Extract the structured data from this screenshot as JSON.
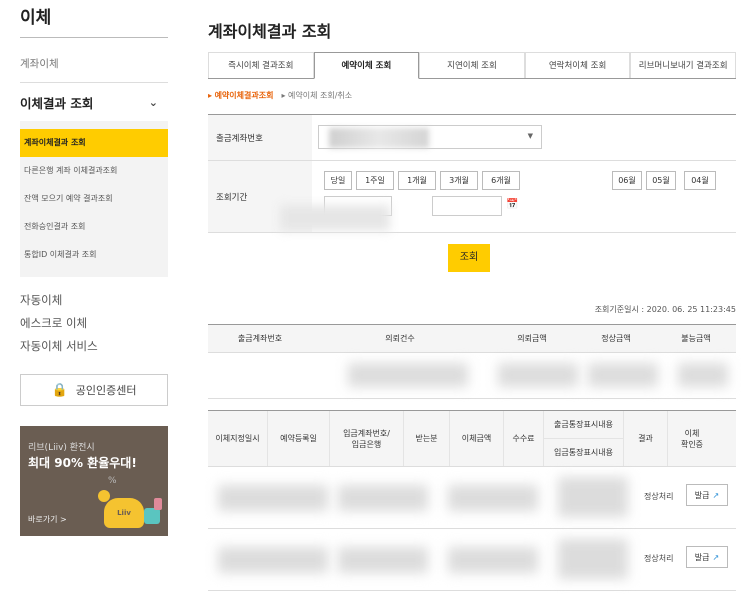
{
  "sidebar": {
    "title": "이체",
    "item_transfer": "계좌이체",
    "group_title": "이체결과 조회",
    "sub_items": [
      "계좌이체결과 조회",
      "다른은행 계좌 이체결과조회",
      "잔액 모으기 예약 결과조회",
      "전화승인결과 조회",
      "통합ID 이체결과 조회"
    ],
    "plain_items": [
      "자동이체",
      "에스크로 이체",
      "자동이체 서비스"
    ],
    "cert_label": "공인인증센터",
    "banner": {
      "line1": "리브(Liiv) 환전시",
      "line2": "최대 90% 환율우대!",
      "link": "바로가기 >",
      "brand": "Liiv",
      "pct": "%"
    }
  },
  "main": {
    "title": "계좌이체결과 조회",
    "tabs": [
      "즉시이체 결과조회",
      "예약이체 조회",
      "지연이체 조회",
      "연락처이체 조회",
      "리브머니보내기 결과조회"
    ],
    "active_tab": 1,
    "breadcrumbs": [
      "예약이체결과조회",
      "예약이체 조회/취소"
    ],
    "form": {
      "account_label": "출금계좌번호",
      "period_label": "조회기간",
      "period_buttons": [
        "당일",
        "1주일",
        "1개월",
        "3개월",
        "6개월"
      ],
      "month_buttons": [
        "06월",
        "05월",
        "04월"
      ]
    },
    "search_button": "조회",
    "basis_time": "조회기준일시 : 2020. 06. 25 11:23:45",
    "summary_table": {
      "headers": [
        "출금계좌번호",
        "의뢰건수",
        "의뢰금액",
        "정상금액",
        "불능금액"
      ]
    },
    "detail_table": {
      "headers": [
        "이체지정일시",
        "예약등록일",
        "입금계좌번호/\n입금은행",
        "받는분",
        "이체금액",
        "수수료",
        "출금통장표시내용",
        "입금통장표시내용",
        "결과",
        "이체\n확인증"
      ],
      "rows": [
        {
          "result": "정상처리",
          "issue": "발급"
        },
        {
          "result": "정상처리",
          "issue": "발급"
        }
      ]
    }
  },
  "colors": {
    "accent": "#ffcc00",
    "crumb": "#e8630a",
    "link_icon": "#2a8fd6"
  }
}
